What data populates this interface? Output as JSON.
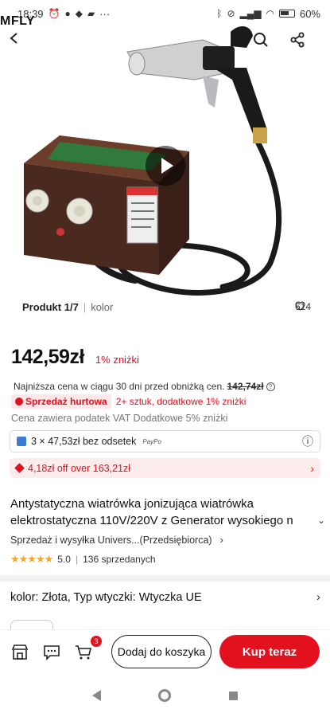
{
  "status_bar": {
    "time": "18:39",
    "battery": "60%",
    "more": "···"
  },
  "brand_overlay": "MFLY",
  "gallery": {
    "product_label": "Produkt 1/7",
    "variant_label": "kolor",
    "likes": "614",
    "device_panel_text": "Electrostatic Eliminator"
  },
  "price": {
    "value": "142,59zł",
    "discount": "1% zniżki",
    "lowest_prefix": "Najniższa cena w ciągu 30 dni przed obniżką cen.",
    "lowest_value": "142,74zł"
  },
  "wholesale": {
    "badge": "Sprzedaż hurtowa",
    "text": "2+ sztuk, dodatkowe 1% zniżki"
  },
  "vat_text": "Cena zawiera podatek VAT Dodatkowe 5% zniżki",
  "installment": {
    "text": "3 × 47,53zł bez odsetek",
    "provider": "PayPo"
  },
  "coupon": {
    "text": "4,18zł off over 163,21zł"
  },
  "product": {
    "title_line1": "Antystatyczna wiatrówka jonizująca wiatrówka",
    "title_line2": "elektrostatyczna 110V/220V z Generator wysokiego n",
    "seller": "Sprzedaż i wysyłka Univers...(Przedsiębiorca)",
    "stars": "★★★★★",
    "rating": "5.0",
    "sold": "136 sprzedanych"
  },
  "variant_selection": "kolor: Złota, Typ wtyczki: Wtyczka UE",
  "bottom_bar": {
    "cart_count": "3",
    "add_to_cart": "Dodaj do koszyka",
    "buy_now": "Kup teraz"
  },
  "colors": {
    "accent": "#e3101e",
    "star": "#f5a623"
  }
}
